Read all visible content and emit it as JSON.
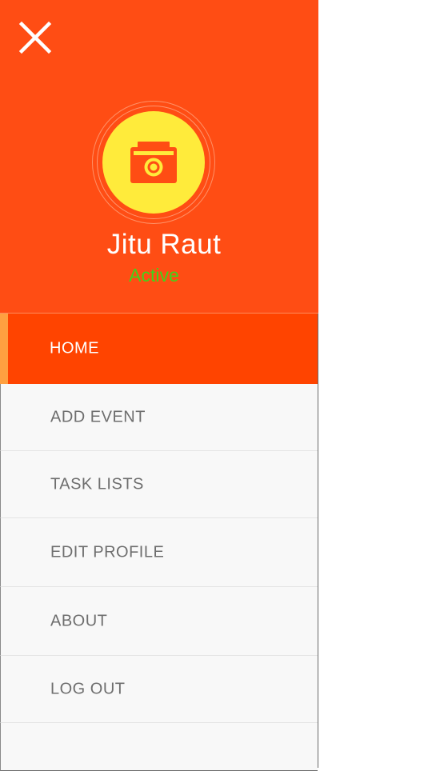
{
  "header": {
    "user_name": "Jitu Raut",
    "status": "Active",
    "avatar_icon": "camera-icon",
    "close_icon": "close-icon"
  },
  "menu": {
    "items": [
      {
        "label": "HOME",
        "active": true
      },
      {
        "label": "ADD EVENT"
      },
      {
        "label": "TASK LISTS"
      },
      {
        "label": "EDIT PROFILE"
      },
      {
        "label": "ABOUT"
      },
      {
        "label": "LOG OUT"
      }
    ]
  },
  "colors": {
    "header_bg": "#ff4d14",
    "active_item_bg": "#ff4400",
    "active_indicator": "#ffa040",
    "avatar_bg": "#ffeb3b",
    "status_text": "#43d21a"
  }
}
